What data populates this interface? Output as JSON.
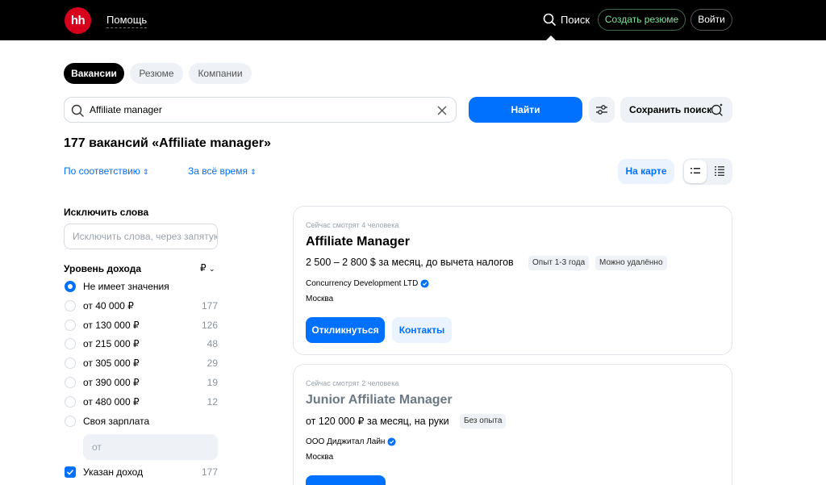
{
  "header": {
    "logo": "hh",
    "help": "Помощь",
    "search": "Поиск",
    "create_resume": "Создать резюме",
    "login": "Войти"
  },
  "tabs": [
    {
      "label": "Вакансии",
      "active": true
    },
    {
      "label": "Резюме",
      "active": false
    },
    {
      "label": "Компании",
      "active": false
    }
  ],
  "search": {
    "value": "Affiliate manager",
    "find_label": "Найти",
    "save_label": "Сохранить поиск"
  },
  "results": {
    "title": "177 вакансий «Affiliate manager»",
    "sort_relevance": "По соответствию",
    "sort_period": "За всё время",
    "map_label": "На карте"
  },
  "sidebar": {
    "exclude_heading": "Исключить слова",
    "exclude_placeholder": "Исключить слова, через запятую",
    "income_heading": "Уровень дохода",
    "currency": "₽",
    "income_options": [
      {
        "label": "Не имеет значения",
        "count": "",
        "selected": true
      },
      {
        "label": "от 40 000 ₽",
        "count": "177",
        "selected": false
      },
      {
        "label": "от 130 000 ₽",
        "count": "126",
        "selected": false
      },
      {
        "label": "от 215 000 ₽",
        "count": "48",
        "selected": false
      },
      {
        "label": "от 305 000 ₽",
        "count": "29",
        "selected": false
      },
      {
        "label": "от 390 000 ₽",
        "count": "19",
        "selected": false
      },
      {
        "label": "от 480 000 ₽",
        "count": "12",
        "selected": false
      },
      {
        "label": "Своя зарплата",
        "count": "",
        "selected": false
      }
    ],
    "salary_placeholder": "от",
    "income_specified": {
      "label": "Указан доход",
      "count": "177",
      "checked": true
    }
  },
  "vacancies": [
    {
      "watching": "Сейчас смотрят 4 человека",
      "title": "Affiliate Manager",
      "salary": "2 500 – 2 800 $ за месяц, до вычета налогов",
      "tags": [
        "Опыт 1-3 года",
        "Можно удалённо"
      ],
      "company": "Concurrency Development LTD",
      "city": "Москва",
      "apply": "Откликнуться",
      "contacts": "Контакты"
    },
    {
      "watching": "Сейчас смотрят 2 человека",
      "title": "Junior Affiliate Manager",
      "salary": "от 120 000 ₽ за месяц, на руки",
      "tags": [
        "Без опыта"
      ],
      "company": "ООО Диджитал Лайн",
      "city": "Москва"
    }
  ],
  "colors": {
    "accent": "#0070ff",
    "brand": "#d6001c",
    "header_bg": "#000000",
    "create_resume_text": "#7ce39a"
  }
}
